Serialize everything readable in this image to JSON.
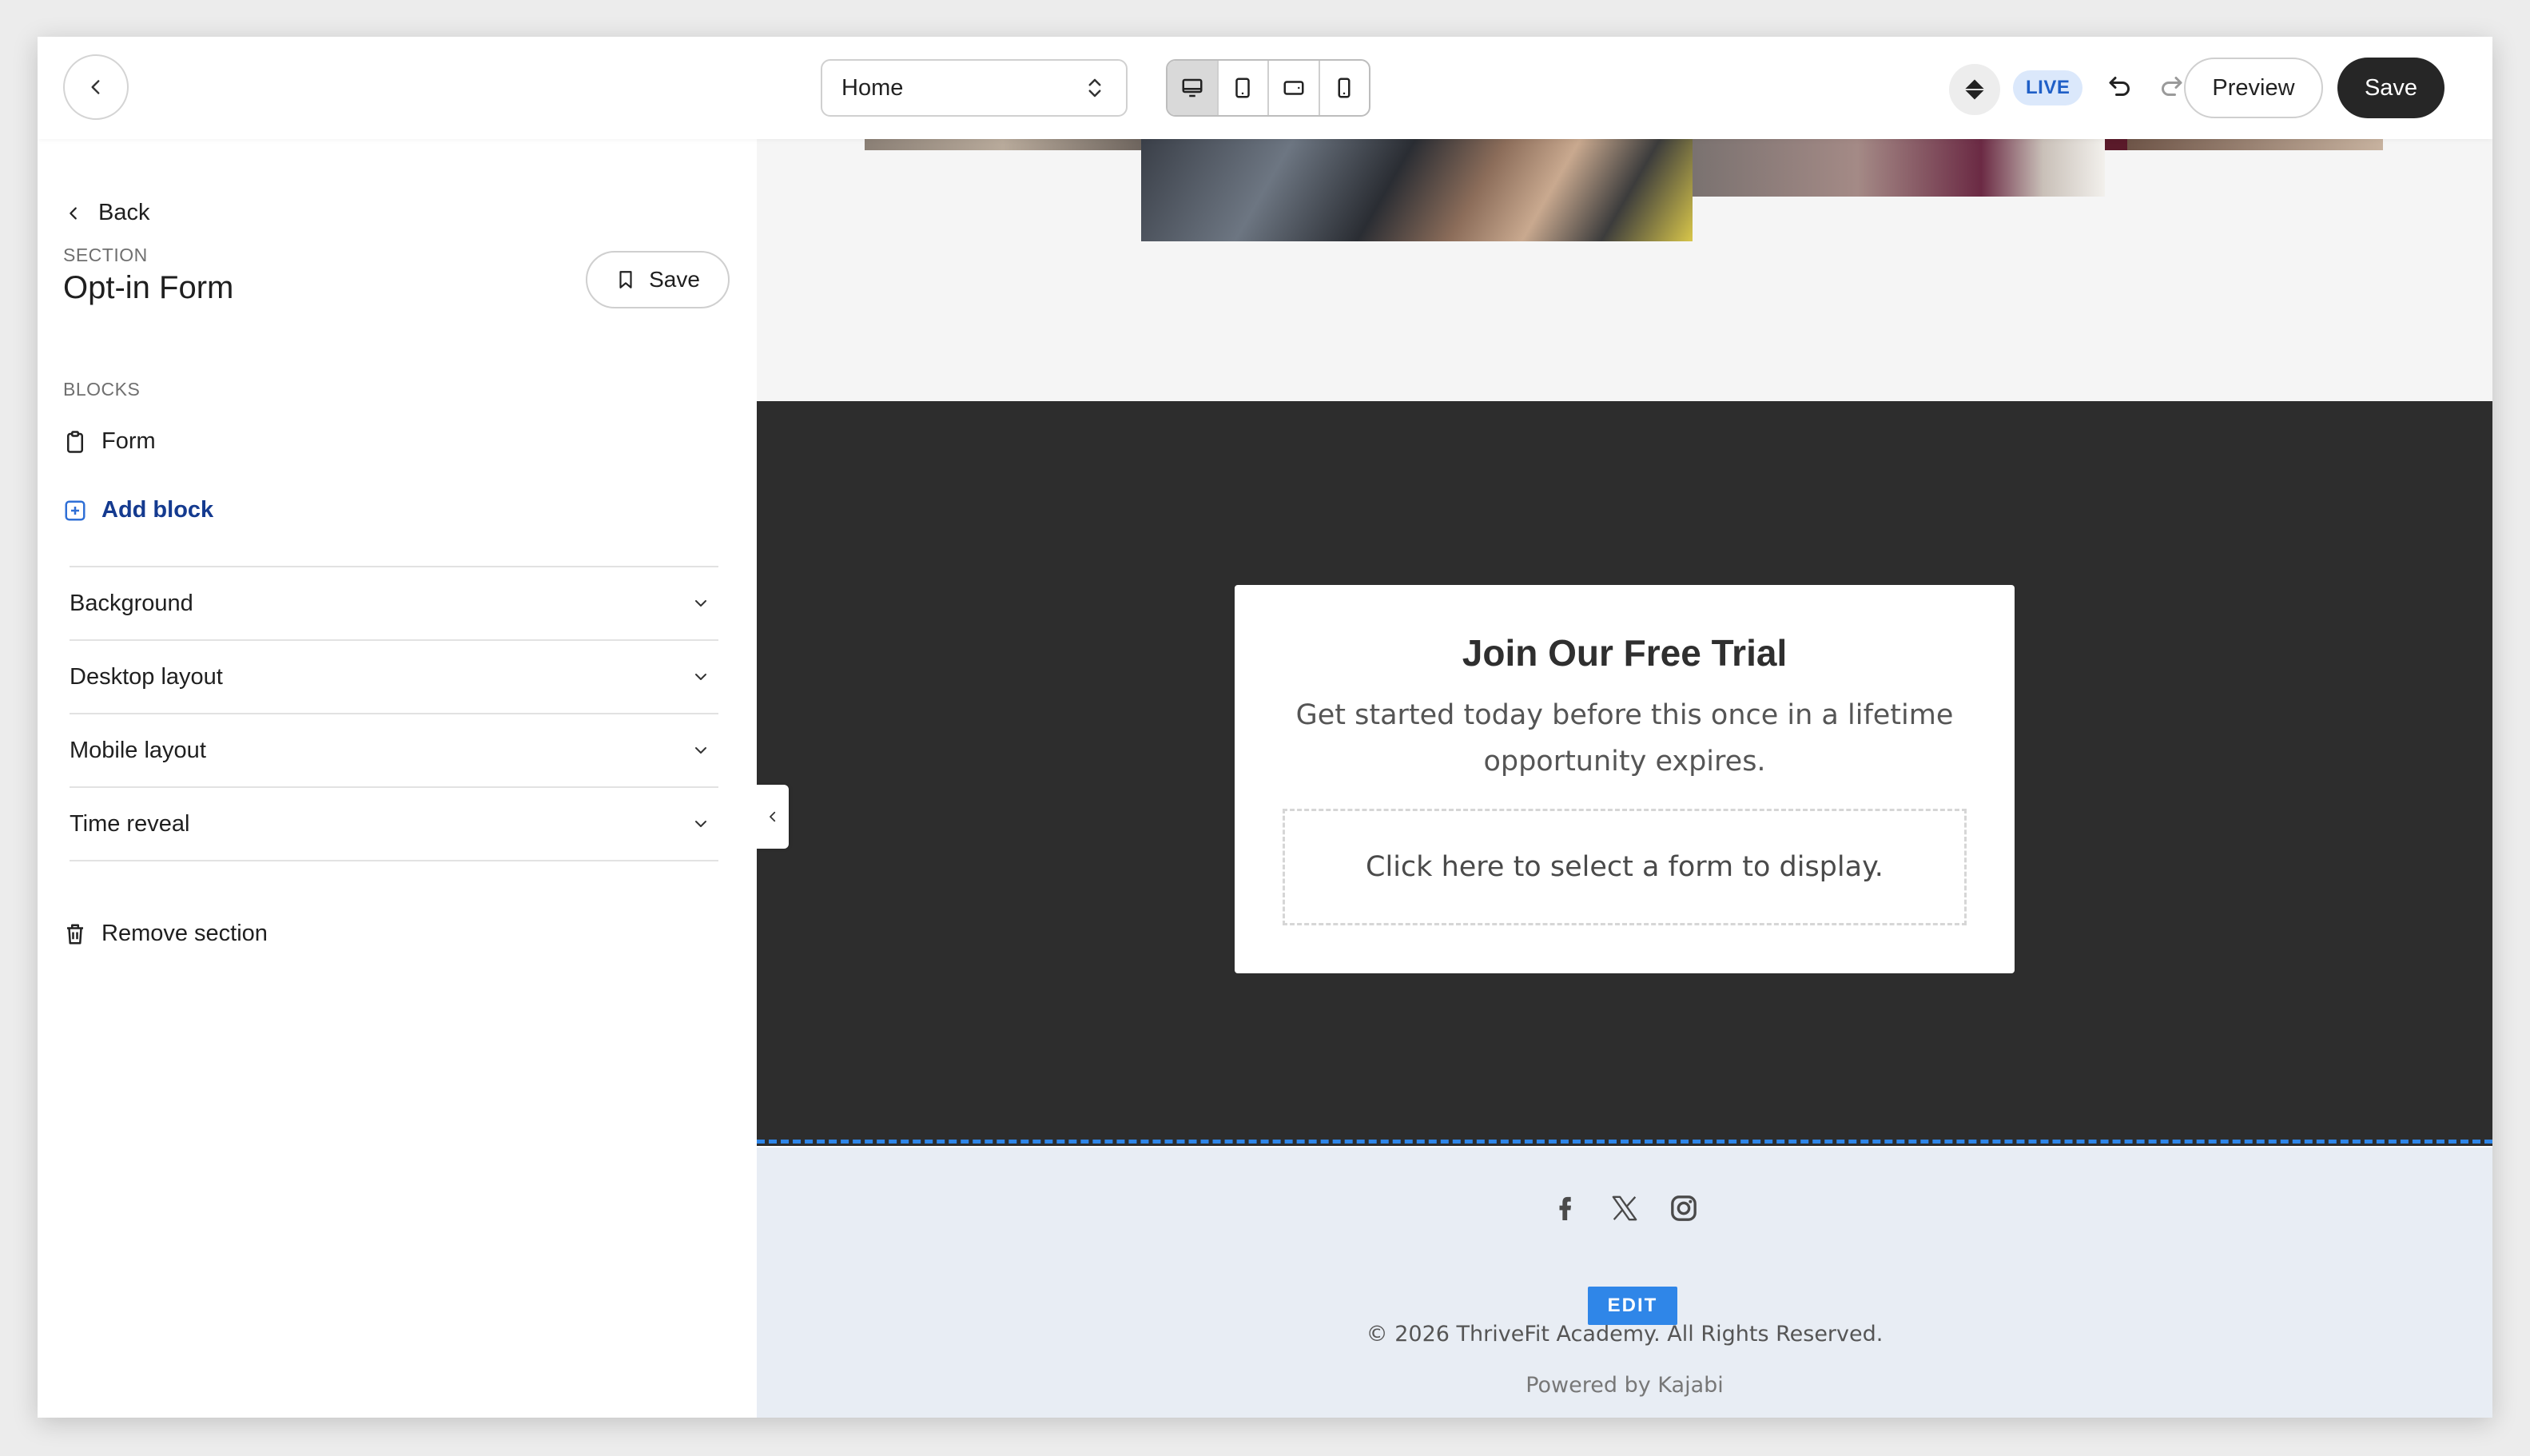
{
  "topbar": {
    "page_select": {
      "value": "Home"
    },
    "device_modes": [
      "desktop",
      "tablet",
      "tablet-landscape",
      "mobile"
    ],
    "active_device": "desktop",
    "status_badge": "LIVE",
    "preview_label": "Preview",
    "save_label": "Save"
  },
  "sidebar": {
    "back_label": "Back",
    "section_eyebrow": "SECTION",
    "section_title": "Opt-in Form",
    "save_label": "Save",
    "blocks_eyebrow": "BLOCKS",
    "blocks": [
      {
        "label": "Form",
        "icon": "clipboard-icon"
      }
    ],
    "add_block_label": "Add block",
    "accordions": [
      {
        "label": "Background"
      },
      {
        "label": "Desktop layout"
      },
      {
        "label": "Mobile layout"
      },
      {
        "label": "Time reveal"
      }
    ],
    "remove_label": "Remove section"
  },
  "canvas": {
    "optin": {
      "title": "Join Our Free Trial",
      "subtitle": "Get started today before this once in a lifetime opportunity expires.",
      "form_placeholder": "Click here to select a form to display."
    },
    "footer": {
      "socials": [
        "facebook-icon",
        "x-icon",
        "instagram-icon"
      ],
      "edit_tag": "EDIT",
      "copyright": "© 2026 ThriveFit Academy. All Rights Reserved.",
      "powered_by": "Powered by Kajabi"
    }
  },
  "colors": {
    "accent_blue": "#2f86e8",
    "link_blue": "#143a8f",
    "dark_section": "#2d2d2d",
    "footer_bg": "#e8edf4",
    "live_badge_bg": "#dbe8fb"
  }
}
